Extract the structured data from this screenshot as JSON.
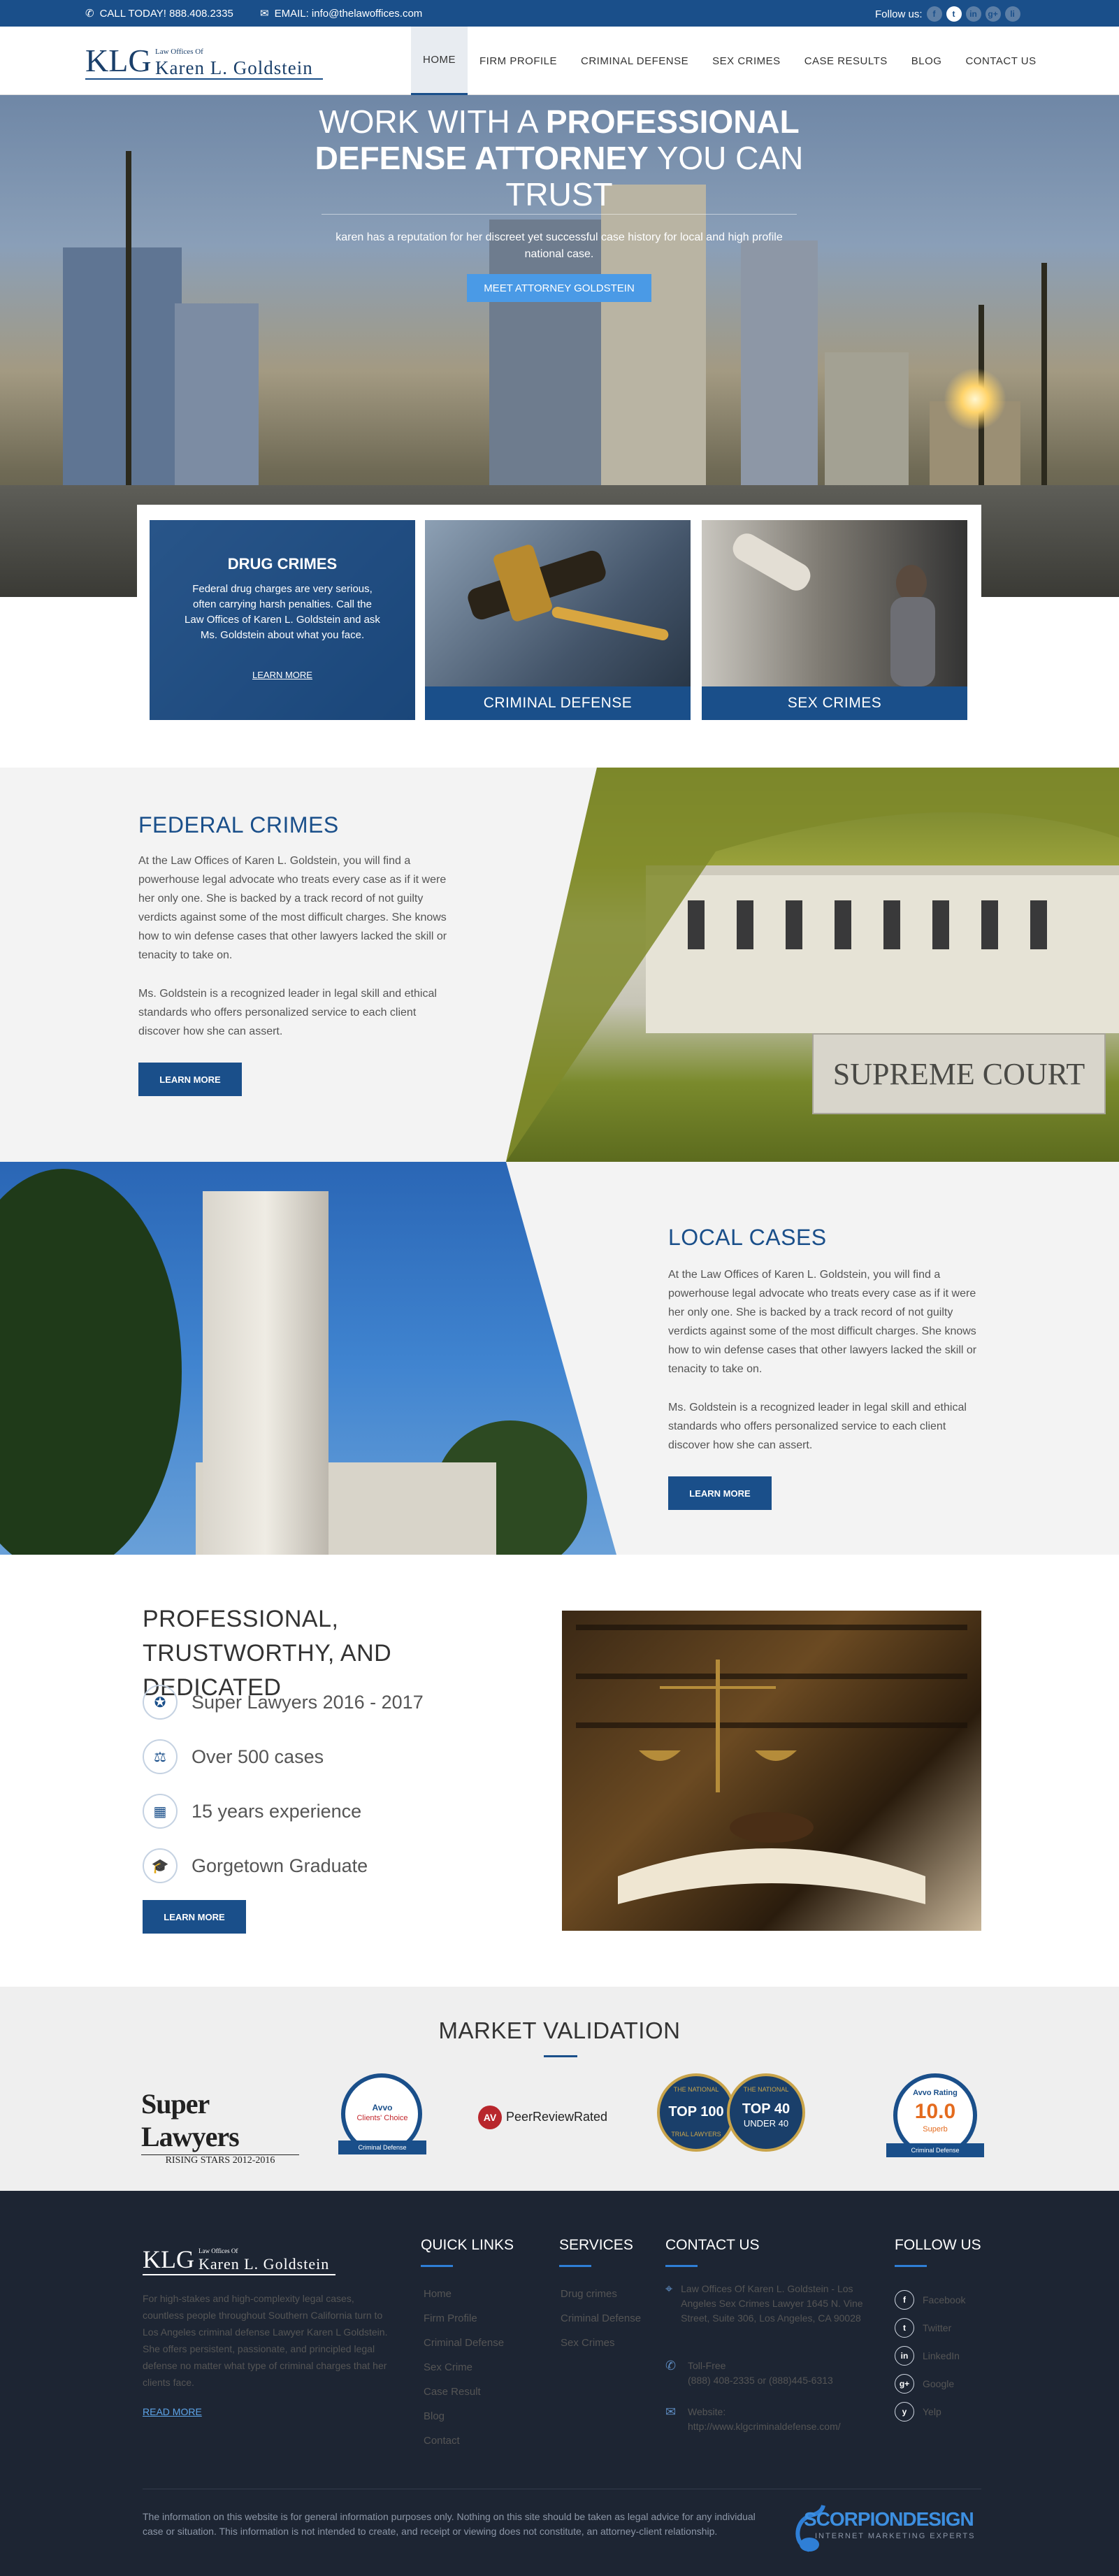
{
  "topbar": {
    "call": "CALL TODAY! 888.408.2335",
    "email": "EMAIL: info@thelawoffices.com",
    "follow": "Follow us:",
    "social": [
      "f",
      "t",
      "in",
      "g+",
      "li"
    ]
  },
  "header": {
    "logo_klg": "KLG",
    "logo_small": "Law Offices Of",
    "logo_name": "Karen L. Goldstein",
    "nav": [
      "HOME",
      "FIRM PROFILE",
      "CRIMINAL DEFENSE",
      "SEX CRIMES",
      "CASE RESULTS",
      "BLOG",
      "CONTACT US"
    ]
  },
  "hero": {
    "title_1": "WORK WITH A ",
    "title_bold_1": "PROFESSIONAL",
    "title_bold_2": "DEFENSE ATTORNEY",
    "title_2": " YOU CAN TRUST",
    "subtitle": "karen has a reputation for her discreet yet successful case history for local and high profile national case.",
    "button": "MEET ATTORNEY GOLDSTEIN"
  },
  "cards": {
    "drug_title": "DRUG CRIMES",
    "drug_text": "Federal drug charges are very serious, often carrying harsh penalties. Call the Law Offices of Karen L. Goldstein and ask Ms. Goldstein about what you face.",
    "drug_link": "LEARN MORE",
    "criminal": "CRIMINAL DEFENSE",
    "sex": "SEX CRIMES"
  },
  "federal": {
    "title": "FEDERAL CRIMES",
    "p1": "At the Law Offices of Karen L. Goldstein, you will find a powerhouse legal advocate who treats every case as if it were her only one. She is backed by a track record of not guilty verdicts against some of the most difficult charges. She knows how to win defense cases that other lawyers lacked the skill or tenacity to take on.",
    "p2": "Ms. Goldstein is a recognized leader in legal skill and ethical standards who offers personalized service to each client discover how she can assert.",
    "button": "LEARN MORE",
    "sign": "SUPREME COURT"
  },
  "local": {
    "title": "LOCAL CASES",
    "p1": "At the Law Offices of Karen L. Goldstein, you will find a powerhouse legal advocate who treats every case as if it were her only one. She is backed by a track record of not guilty verdicts against some of the most difficult charges. She knows how to win defense cases that other lawyers lacked the skill or tenacity to take on.",
    "p2": "Ms. Goldstein is a recognized leader in legal skill and ethical standards who offers personalized service to each client discover how she can assert.",
    "button": "LEARN MORE"
  },
  "professional": {
    "title": "PROFESSIONAL, TRUSTWORTHY, AND DEDICATED",
    "stats": [
      "Super Lawyers 2016 - 2017",
      "Over 500 cases",
      "15 years experience",
      "Gorgetown Graduate"
    ],
    "button": "LEARN MORE"
  },
  "market": {
    "title": "MARKET VALIDATION",
    "superlawyers": "Super Lawyers",
    "superlawyers_sub": "RISING STARS 2012-2016",
    "avvo_choice": "Avvo",
    "avvo_choice_sub": "Clients' Choice",
    "avvo_choice_band": "Criminal Defense",
    "peer": "PeerReviewRated",
    "peer_av": "AV",
    "top100": "TOP 100",
    "top100_top": "THE NATIONAL",
    "top100_bottom": "TRIAL LAWYERS",
    "top40": "TOP 40",
    "top40_sub": "UNDER 40",
    "avvo_rating": "Avvo Rating",
    "avvo_score": "10.0",
    "avvo_superb": "Superb",
    "avvo_band": "Criminal Defense"
  },
  "footer": {
    "logo_klg": "KLG",
    "logo_small": "Law Offices Of",
    "logo_name": "Karen L. Goldstein",
    "about": "For high-stakes and high-complexity legal cases, countless people throughout Southern California turn to Los Angeles criminal defense Lawyer Karen L Goldstein. She offers persistent, passionate, and principled legal defense no matter what type of criminal charges that her clients face.",
    "read_more": "READ MORE",
    "quick_title": "QUICK LINKS",
    "quick": [
      "Home",
      "Firm Profile",
      "Criminal Defense",
      "Sex Crime",
      "Case Result",
      "Blog",
      "Contact"
    ],
    "services_title": "SERVICES",
    "services": [
      "Drug crimes",
      "Criminal Defense",
      "Sex Crimes"
    ],
    "contact_title": "CONTACT US",
    "address": "Law Offices Of Karen L. Goldstein - Los Angeles Sex Crimes Lawyer 1645 N. Vine Street, Suite 306, Los Angeles, CA 90028",
    "tollfree_label": "Toll-Free",
    "tollfree": "(888) 408-2335 or (888)445-6313",
    "website_label": "Website:",
    "website": "http://www.klgcriminaldefense.com/",
    "follow_title": "FOLLOW US",
    "follow": [
      "Facebook",
      "Twitter",
      "LinkedIn",
      "Google",
      "Yelp"
    ],
    "disclaimer": "The information on this website is for general information purposes only. Nothing on this site should be taken as legal advice for any individual case or situation. This information is not intended to create, and receipt or viewing does not constitute, an attorney-client relationship.",
    "scorpion": "SCORPIONDESIGN",
    "scorpion_sub": "INTERNET MARKETING EXPERTS"
  },
  "colors": {
    "primary": "#1a4f8a",
    "accent": "#4a9ae6",
    "footer": "#1d2533"
  }
}
